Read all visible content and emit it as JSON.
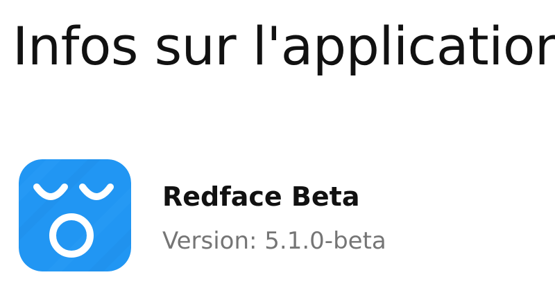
{
  "header": {
    "title": "Infos sur l'application"
  },
  "app": {
    "name": "Redface Beta",
    "version": "Version: 5.1.0-beta",
    "icon": "redface-app-icon",
    "icon_color": "#2196F3"
  }
}
